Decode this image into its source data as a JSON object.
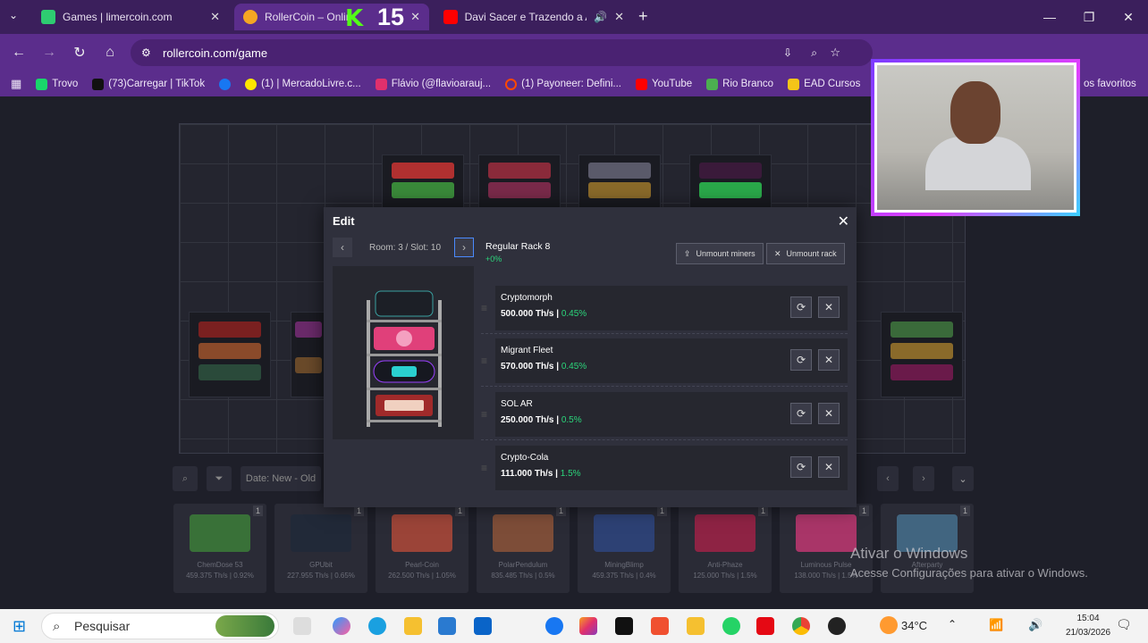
{
  "tabs": [
    {
      "title": "Games | limercoin.com",
      "close": "✕"
    },
    {
      "title": "RollerCoin – Online",
      "close": "✕"
    },
    {
      "title": "Davi Sacer e Trazendo a Arc",
      "close": "✕"
    }
  ],
  "overlay": {
    "kick_letter": "K",
    "kick_number": "15"
  },
  "window_controls": {
    "minimize": "—",
    "maximize": "❐",
    "close": "✕"
  },
  "new_tab": "+",
  "address_bar": {
    "url": "rollercoin.com/game"
  },
  "bookmarks": [
    {
      "label": "Trovo",
      "color": "#19d66b"
    },
    {
      "label": "(73)Carregar | TikTok",
      "color": "#111111"
    },
    {
      "label": "",
      "color": "#1877f2"
    },
    {
      "label": "(1) | MercadoLivre.c...",
      "color": "#ffe600"
    },
    {
      "label": "Flávio (@flavioarauj...",
      "color": "#e1306c"
    },
    {
      "label": "(1) Payoneer: Defini...",
      "color": "#ff4800"
    },
    {
      "label": "YouTube",
      "color": "#ff0000"
    },
    {
      "label": "Rio Branco",
      "color": "#4caf50"
    },
    {
      "label": "EAD Cursos",
      "color": "#f5c518"
    },
    {
      "label": "os favoritos",
      "color": ""
    }
  ],
  "dialog": {
    "title": "Edit",
    "close": "✕",
    "room_slot": "Room: 3 / Slot: 10",
    "prev": "‹",
    "next": "›",
    "rack_name": "Regular Rack 8",
    "rack_bonus": "+0%",
    "unmount_miners": "Unmount miners",
    "unmount_rack": "Unmount rack",
    "miners": [
      {
        "name": "Cryptomorph",
        "power": "500.000 Th/s",
        "bonus": "0.45%"
      },
      {
        "name": "Migrant Fleet",
        "power": "570.000 Th/s",
        "bonus": "0.45%"
      },
      {
        "name": "SOL AR",
        "power": "250.000 Th/s",
        "bonus": "0.5%"
      },
      {
        "name": "Crypto-Cola",
        "power": "111.000 Th/s",
        "bonus": "1.5%"
      }
    ]
  },
  "inventory": {
    "sort_label": "Date: New - Old",
    "items": [
      {
        "name": "ChemDose 53",
        "power": "459.375 Th/s",
        "bonus": "0.92%",
        "count": "1",
        "color": "#3f8a3a"
      },
      {
        "name": "GPUbit",
        "power": "227.955 Th/s",
        "bonus": "0.65%",
        "count": "1",
        "color": "#1f2a3a"
      },
      {
        "name": "Pearl-Coin",
        "power": "262.500 Th/s",
        "bonus": "1.05%",
        "count": "1",
        "color": "#c24d3a"
      },
      {
        "name": "PolarPendulum",
        "power": "835.485 Th/s",
        "bonus": "0.5%",
        "count": "1",
        "color": "#9a5a3a"
      },
      {
        "name": "MiningBlimp",
        "power": "459.375 Th/s",
        "bonus": "0.4%",
        "count": "1",
        "color": "#2f4a8a"
      },
      {
        "name": "Anti-Phaze",
        "power": "125.000 Th/s",
        "bonus": "1.5%",
        "count": "1",
        "color": "#b0224a"
      },
      {
        "name": "Luminous Pulse",
        "power": "138.000 Th/s",
        "bonus": "1.5%",
        "count": "1",
        "color": "#d43a7a"
      },
      {
        "name": "Afterparty",
        "power": "",
        "bonus": "",
        "count": "1",
        "color": "#4a7a9a"
      }
    ]
  },
  "watermark": {
    "line1": "Ativar o Windows",
    "line2": "Acesse Configurações para ativar o Windows."
  },
  "taskbar": {
    "search_placeholder": "Pesquisar",
    "temperature": "34°C",
    "time": "15:04",
    "date": "21/03/2026"
  }
}
